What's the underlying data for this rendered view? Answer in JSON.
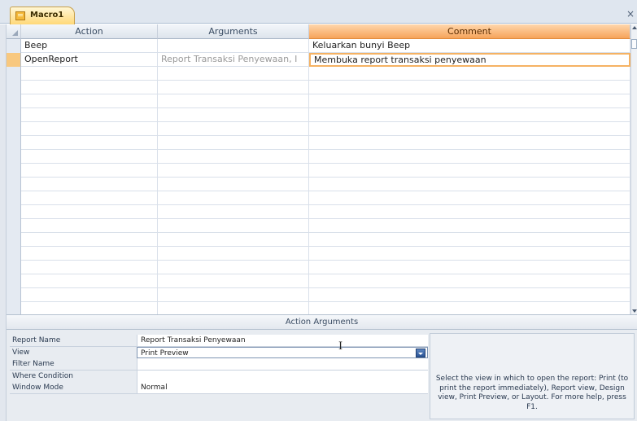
{
  "window": {
    "tab_title": "Macro1",
    "close_glyph": "×"
  },
  "grid": {
    "columns": [
      "Action",
      "Arguments",
      "Comment"
    ],
    "rows": [
      {
        "action": "Beep",
        "arguments": "",
        "comment": "Keluarkan bunyi Beep"
      },
      {
        "action": "OpenReport",
        "arguments": "Report Transaksi Penyewaan, I",
        "comment": "Membuka report transaksi penyewaan"
      }
    ],
    "current_row_index": 1
  },
  "action_arguments": {
    "title": "Action Arguments",
    "fields": [
      {
        "label": "Report Name",
        "value": "Report Transaksi Penyewaan"
      },
      {
        "label": "View",
        "value": "Print Preview"
      },
      {
        "label": "Filter Name",
        "value": ""
      },
      {
        "label": "Where Condition",
        "value": ""
      },
      {
        "label": "Window Mode",
        "value": "Normal"
      }
    ],
    "help": "Select the view in which to open the report: Print (to print the report immediately), Report view, Design view, Print Preview, or Layout. For more help, press F1."
  },
  "colors": {
    "accent_orange": "#f6a35a",
    "header_blue": "#dde4ec",
    "dropdown_blue": "#2c5596"
  },
  "icons": [
    "macro-icon",
    "close-icon",
    "dropdown-arrow-icon",
    "text-cursor-icon"
  ]
}
